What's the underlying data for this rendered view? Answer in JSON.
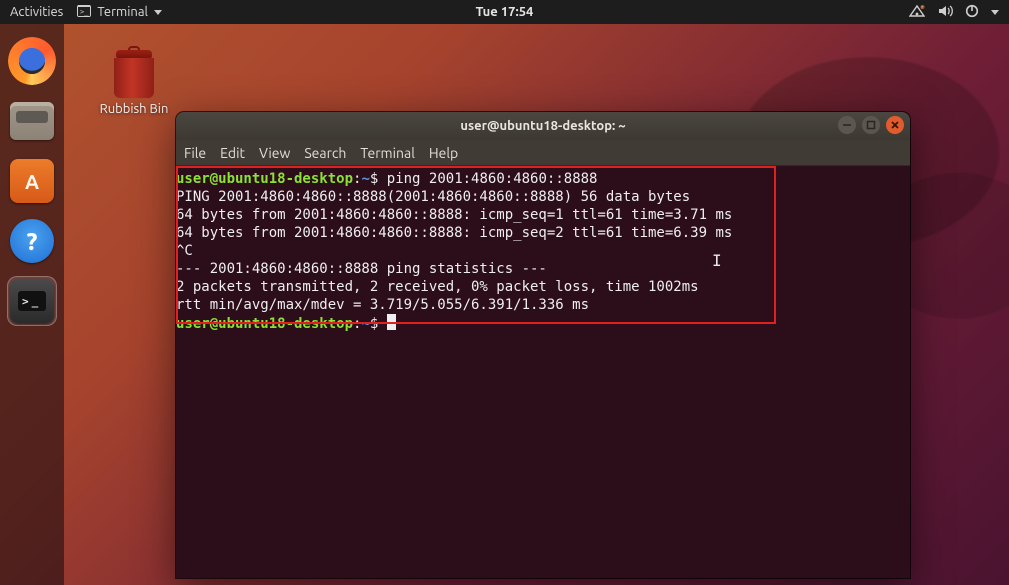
{
  "topbar": {
    "activities": "Activities",
    "app_name": "Terminal",
    "clock": "Tue 17:54"
  },
  "desktop": {
    "trash_label": "Rubbish Bin"
  },
  "window": {
    "title": "user@ubuntu18-desktop: ~",
    "menus": [
      "File",
      "Edit",
      "View",
      "Search",
      "Terminal",
      "Help"
    ]
  },
  "terminal": {
    "prompt_user": "user@ubuntu18-desktop",
    "prompt_path": "~",
    "prompt_suffix": "$",
    "command1": "ping 2001:4860:4860::8888",
    "output_lines": [
      "PING 2001:4860:4860::8888(2001:4860:4860::8888) 56 data bytes",
      "64 bytes from 2001:4860:4860::8888: icmp_seq=1 ttl=61 time=3.71 ms",
      "64 bytes from 2001:4860:4860::8888: icmp_seq=2 ttl=61 time=6.39 ms",
      "^C",
      "--- 2001:4860:4860::8888 ping statistics ---",
      "2 packets transmitted, 2 received, 0% packet loss, time 1002ms",
      "rtt min/avg/max/mdev = 3.719/5.055/6.391/1.336 ms"
    ]
  }
}
